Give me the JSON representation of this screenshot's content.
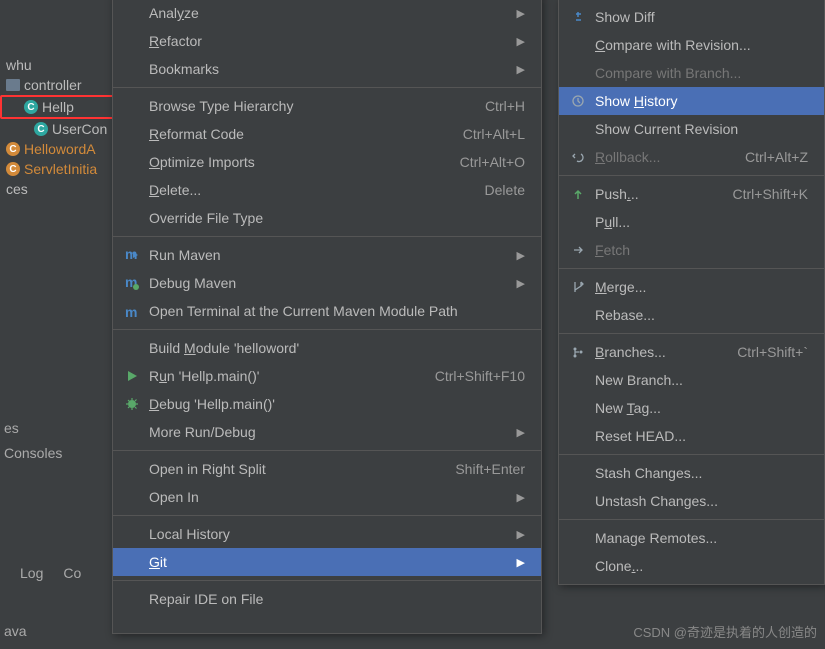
{
  "tree": {
    "root": "whu",
    "folder": "controller",
    "file_hellp": "Hellp",
    "file_usercon": "UserCon",
    "file_hello": "HellowordA",
    "file_servlet": "ServletInitia",
    "truncated": "ces"
  },
  "bottom": {
    "tab_log": "Log",
    "tab_co": "Co",
    "tab_es": "es",
    "tab_consoles": "Consoles",
    "bar": "ava"
  },
  "main_menu": [
    {
      "label": "Analyze",
      "u": 4,
      "arrow": true
    },
    {
      "label": "Refactor",
      "u": 0,
      "arrow": true
    },
    {
      "label": "Bookmarks",
      "arrow": true
    },
    "---",
    {
      "label": "Browse Type Hierarchy",
      "short": "Ctrl+H"
    },
    {
      "label": "Reformat Code",
      "u": 0,
      "short": "Ctrl+Alt+L"
    },
    {
      "label": "Optimize Imports",
      "u": 0,
      "short": "Ctrl+Alt+O"
    },
    {
      "label": "Delete...",
      "u": 0,
      "short": "Delete"
    },
    {
      "label": "Override File Type"
    },
    "---",
    {
      "label": "Run Maven",
      "icon": "maven-run",
      "arrow": true
    },
    {
      "label": "Debug Maven",
      "icon": "maven-debug",
      "arrow": true
    },
    {
      "label": "Open Terminal at the Current Maven Module Path",
      "icon": "maven-term"
    },
    "---",
    {
      "label": "Build Module 'helloword'",
      "u": 6
    },
    {
      "label": "Run 'Hellp.main()'",
      "u": 1,
      "icon": "run",
      "short": "Ctrl+Shift+F10"
    },
    {
      "label": "Debug 'Hellp.main()'",
      "u": 0,
      "icon": "debug"
    },
    {
      "label": "More Run/Debug",
      "arrow": true
    },
    "---",
    {
      "label": "Open in Right Split",
      "short": "Shift+Enter"
    },
    {
      "label": "Open In",
      "arrow": true
    },
    "---",
    {
      "label": "Local History",
      "arrow": true
    },
    {
      "label": "Git",
      "u": 0,
      "arrow": true,
      "sel": true
    },
    "---",
    {
      "label": "Repair IDE on File"
    }
  ],
  "git_menu": [
    {
      "label": "Show Diff",
      "icon": "diff"
    },
    {
      "label": "Compare with Revision...",
      "u": 0
    },
    {
      "label": "Compare with Branch...",
      "disabled": true
    },
    {
      "label": "Show History",
      "u": 5,
      "icon": "history",
      "sel": true
    },
    {
      "label": "Show Current Revision"
    },
    {
      "label": "Rollback...",
      "u": 0,
      "icon": "rollback",
      "short": "Ctrl+Alt+Z",
      "disabled": true
    },
    "---",
    {
      "label": "Push...",
      "u": 4,
      "icon": "push",
      "short": "Ctrl+Shift+K"
    },
    {
      "label": "Pull...",
      "u": 1
    },
    {
      "label": "Fetch",
      "u": 0,
      "icon": "fetch",
      "disabled": true
    },
    "---",
    {
      "label": "Merge...",
      "u": 0,
      "icon": "merge"
    },
    {
      "label": "Rebase..."
    },
    "---",
    {
      "label": "Branches...",
      "u": 0,
      "icon": "branch",
      "short": "Ctrl+Shift+`"
    },
    {
      "label": "New Branch..."
    },
    {
      "label": "New Tag...",
      "u": 4
    },
    {
      "label": "Reset HEAD..."
    },
    "---",
    {
      "label": "Stash Changes..."
    },
    {
      "label": "Unstash Changes..."
    },
    "---",
    {
      "label": "Manage Remotes..."
    },
    {
      "label": "Clone...",
      "u": 5
    }
  ],
  "watermark": "CSDN @奇迹是执着的人创造的"
}
